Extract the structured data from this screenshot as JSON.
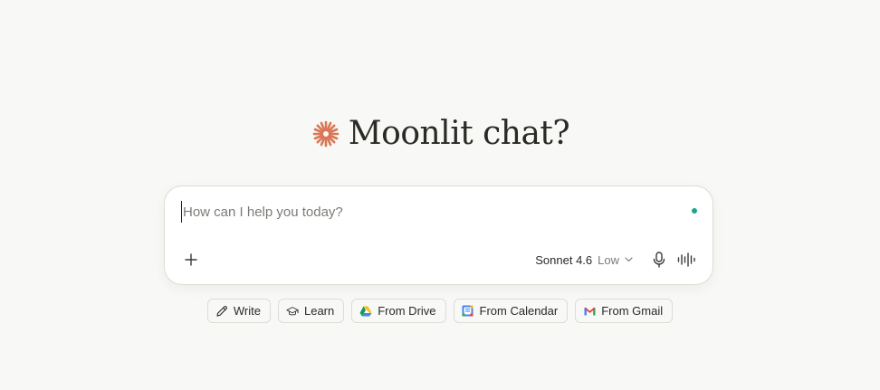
{
  "greeting": {
    "text": "Moonlit chat?",
    "icon": "spark-icon",
    "icon_color": "#d97757"
  },
  "composer": {
    "placeholder": "How can I help you today?",
    "value": "",
    "status_dot_color": "#1aa58b",
    "model": "Sonnet 4.6",
    "effort": "Low",
    "add_icon": "plus-icon",
    "mic_icon": "microphone-icon",
    "voice_icon": "voice-waveform-icon"
  },
  "chips": [
    {
      "label": "Write",
      "icon": "pencil-icon"
    },
    {
      "label": "Learn",
      "icon": "graduation-cap-icon"
    },
    {
      "label": "From Drive",
      "icon": "google-drive-icon"
    },
    {
      "label": "From Calendar",
      "icon": "google-calendar-icon"
    },
    {
      "label": "From Gmail",
      "icon": "gmail-icon"
    }
  ]
}
